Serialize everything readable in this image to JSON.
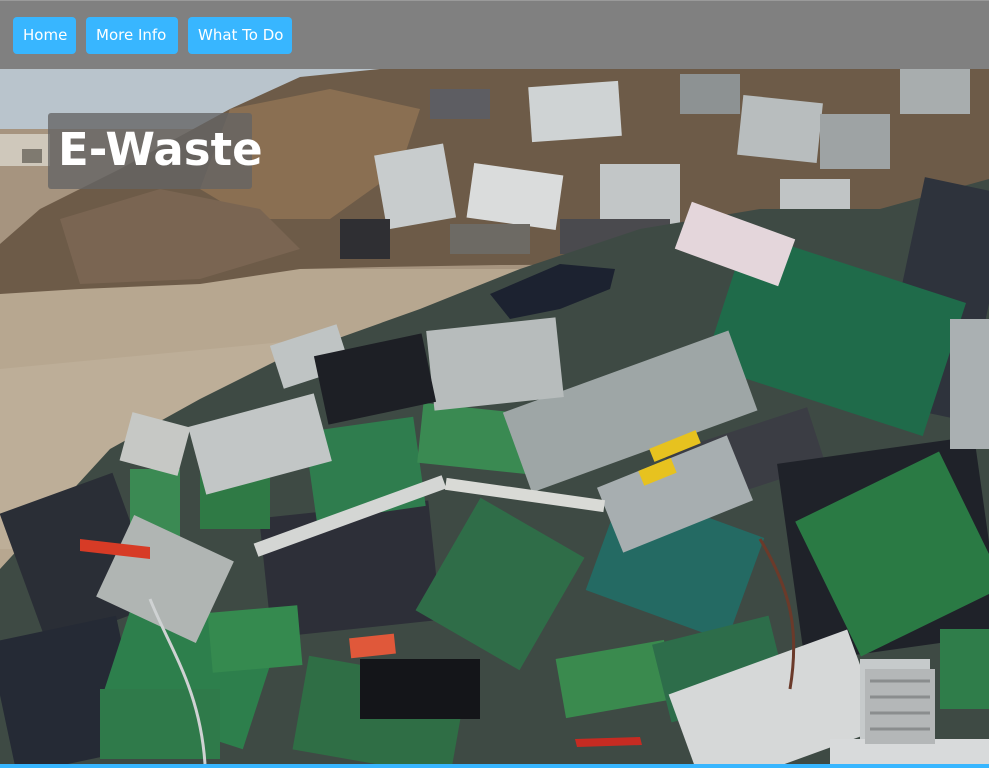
{
  "nav": {
    "items": [
      {
        "label": "Home"
      },
      {
        "label": "More Info"
      },
      {
        "label": "What To Do"
      }
    ]
  },
  "hero": {
    "title": "E-Waste",
    "image_icon": "electronic-waste-photo"
  },
  "colors": {
    "nav_background": "#808080",
    "button_background": "#38b6ff",
    "button_text": "#ffffff",
    "title_overlay": "#646464"
  }
}
